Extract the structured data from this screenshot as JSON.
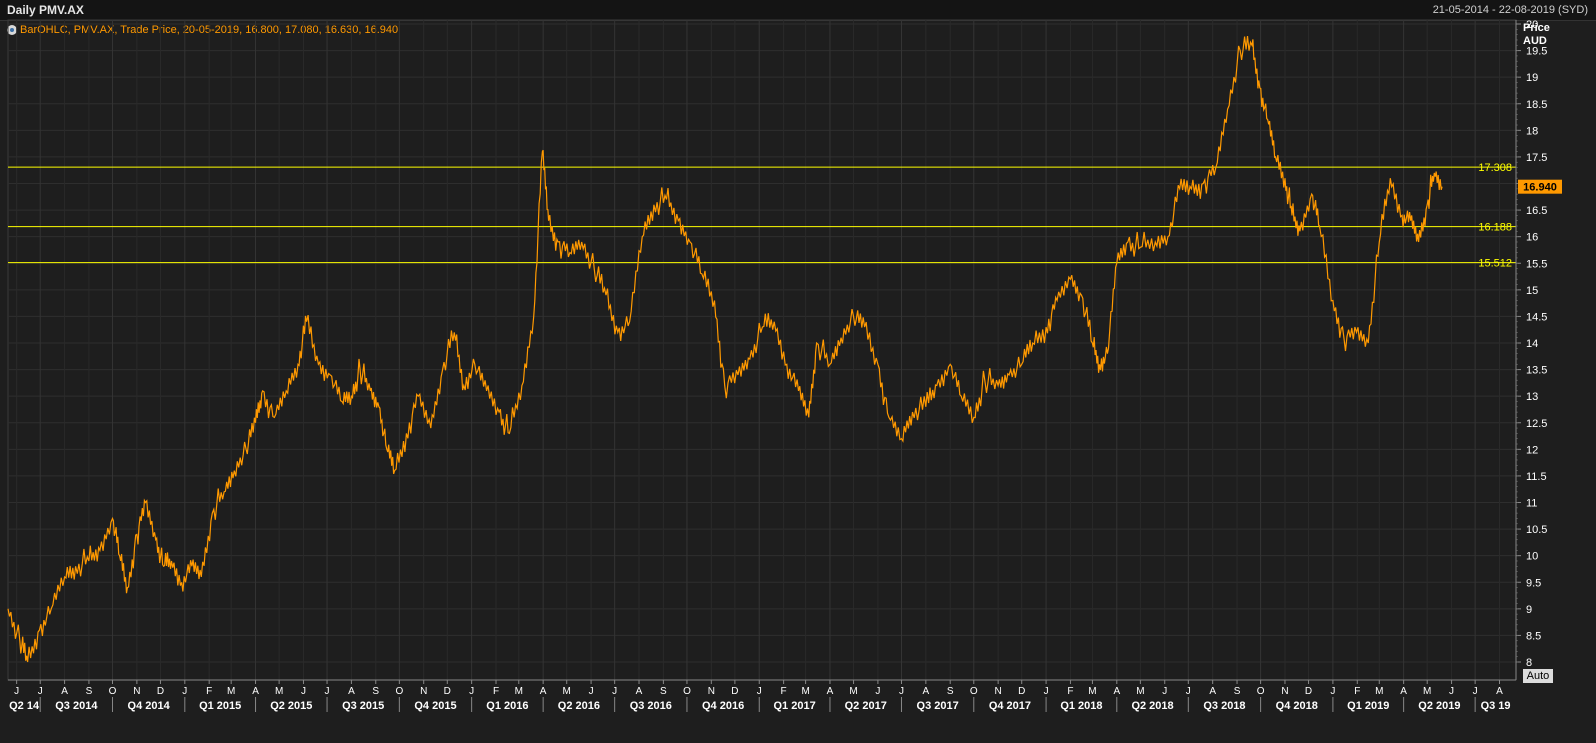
{
  "header": {
    "title": "Daily PMV.AX",
    "date_range": "21-05-2014 - 22-08-2019 (SYD)"
  },
  "legend_text": "BarOHLC, PMV.AX, Trade Price, 20-05-2019, 16.800, 17.080, 16.630, 16.940",
  "axis_title_line1": "Price",
  "axis_title_line2": "AUD",
  "auto_label": "Auto",
  "colors": {
    "background": "#1e1e1e",
    "grid": "#2e2e2e",
    "series": "#ff9900",
    "level_lines": "#ffff00",
    "last_price_bg": "#ff9900"
  },
  "chart_data": {
    "type": "line",
    "title": "Daily PMV.AX",
    "ylabel": "Price AUD",
    "ylim": [
      8,
      20
    ],
    "y_ticks": [
      "8",
      "8.5",
      "9",
      "9.5",
      "10",
      "10.5",
      "11",
      "11.5",
      "12",
      "12.5",
      "13",
      "13.5",
      "14",
      "14.5",
      "15",
      "15.5",
      "16",
      "16.5",
      "17",
      "17.5",
      "18",
      "18.5",
      "19",
      "19.5",
      "20"
    ],
    "month_labels": [
      "J",
      "J",
      "A",
      "S",
      "O",
      "N",
      "D",
      "J",
      "F",
      "M",
      "A",
      "M",
      "J",
      "J",
      "A",
      "S",
      "O",
      "N",
      "D",
      "J",
      "F",
      "M",
      "A",
      "M",
      "J",
      "J",
      "A",
      "S",
      "O",
      "N",
      "D",
      "J",
      "F",
      "M",
      "A",
      "M",
      "J",
      "J",
      "A",
      "S",
      "O",
      "N",
      "D",
      "J",
      "F",
      "M",
      "A",
      "M",
      "J",
      "J",
      "A",
      "S",
      "O",
      "N",
      "D",
      "J",
      "F",
      "M",
      "A",
      "M",
      "J",
      "J",
      "A"
    ],
    "quarter_labels": [
      "Q2 14",
      "Q3 2014",
      "Q4 2014",
      "Q1 2015",
      "Q2 2015",
      "Q3 2015",
      "Q4 2015",
      "Q1 2016",
      "Q2 2016",
      "Q3 2016",
      "Q4 2016",
      "Q1 2017",
      "Q2 2017",
      "Q3 2017",
      "Q4 2017",
      "Q1 2018",
      "Q2 2018",
      "Q3 2018",
      "Q4 2018",
      "Q1 2019",
      "Q2 2019",
      "Q3 19"
    ],
    "horizontal_lines": [
      {
        "value": 17.308,
        "label": "17.308"
      },
      {
        "value": 16.188,
        "label": "16.188"
      },
      {
        "value": 15.512,
        "label": "15.512"
      }
    ],
    "last_price": {
      "value": 16.94,
      "label": "16.940"
    },
    "series": [
      {
        "name": "PMV.AX",
        "points": [
          [
            "2014-05-21",
            9.0
          ],
          [
            "2014-06-05",
            8.4
          ],
          [
            "2014-06-15",
            8.0
          ],
          [
            "2014-06-30",
            8.6
          ],
          [
            "2014-07-15",
            9.0
          ],
          [
            "2014-08-01",
            9.6
          ],
          [
            "2014-08-15",
            9.8
          ],
          [
            "2014-09-01",
            9.9
          ],
          [
            "2014-09-15",
            10.1
          ],
          [
            "2014-10-01",
            10.7
          ],
          [
            "2014-10-10",
            10.0
          ],
          [
            "2014-10-20",
            9.4
          ],
          [
            "2014-11-01",
            10.4
          ],
          [
            "2014-11-12",
            11.0
          ],
          [
            "2014-11-25",
            10.3
          ],
          [
            "2014-12-05",
            9.8
          ],
          [
            "2014-12-15",
            9.9
          ],
          [
            "2014-12-28",
            9.5
          ],
          [
            "2015-01-10",
            9.8
          ],
          [
            "2015-01-22",
            9.6
          ],
          [
            "2015-02-05",
            10.8
          ],
          [
            "2015-02-20",
            11.2
          ],
          [
            "2015-03-05",
            11.6
          ],
          [
            "2015-03-20",
            12.0
          ],
          [
            "2015-04-01",
            12.5
          ],
          [
            "2015-04-10",
            13.1
          ],
          [
            "2015-04-25",
            12.6
          ],
          [
            "2015-05-10",
            13.1
          ],
          [
            "2015-05-25",
            13.6
          ],
          [
            "2015-06-05",
            14.4
          ],
          [
            "2015-06-20",
            13.6
          ],
          [
            "2015-07-05",
            13.4
          ],
          [
            "2015-07-20",
            12.9
          ],
          [
            "2015-08-01",
            13.0
          ],
          [
            "2015-08-12",
            13.5
          ],
          [
            "2015-08-25",
            13.1
          ],
          [
            "2015-09-05",
            12.8
          ],
          [
            "2015-09-15",
            12.0
          ],
          [
            "2015-09-25",
            11.6
          ],
          [
            "2015-10-10",
            12.3
          ],
          [
            "2015-10-25",
            13.0
          ],
          [
            "2015-11-10",
            12.4
          ],
          [
            "2015-11-25",
            13.5
          ],
          [
            "2015-12-10",
            14.2
          ],
          [
            "2015-12-22",
            13.2
          ],
          [
            "2016-01-05",
            13.6
          ],
          [
            "2016-01-20",
            13.1
          ],
          [
            "2016-02-05",
            12.7
          ],
          [
            "2016-02-18",
            12.3
          ],
          [
            "2016-03-05",
            13.2
          ],
          [
            "2016-03-20",
            14.5
          ],
          [
            "2016-03-31",
            17.6
          ],
          [
            "2016-04-08",
            16.3
          ],
          [
            "2016-04-20",
            15.9
          ],
          [
            "2016-05-05",
            15.7
          ],
          [
            "2016-05-20",
            15.9
          ],
          [
            "2016-06-05",
            15.4
          ],
          [
            "2016-06-20",
            14.9
          ],
          [
            "2016-07-05",
            14.2
          ],
          [
            "2016-07-20",
            14.4
          ],
          [
            "2016-08-05",
            16.0
          ],
          [
            "2016-08-20",
            16.6
          ],
          [
            "2016-09-05",
            16.7
          ],
          [
            "2016-09-20",
            16.3
          ],
          [
            "2016-10-05",
            15.9
          ],
          [
            "2016-10-20",
            15.3
          ],
          [
            "2016-11-05",
            14.8
          ],
          [
            "2016-11-18",
            13.2
          ],
          [
            "2016-12-05",
            13.4
          ],
          [
            "2016-12-20",
            13.7
          ],
          [
            "2017-01-05",
            14.3
          ],
          [
            "2017-01-20",
            14.4
          ],
          [
            "2017-02-05",
            13.6
          ],
          [
            "2017-02-20",
            13.1
          ],
          [
            "2017-03-05",
            12.6
          ],
          [
            "2017-03-15",
            14.0
          ],
          [
            "2017-04-01",
            13.6
          ],
          [
            "2017-04-15",
            14.1
          ],
          [
            "2017-05-01",
            14.5
          ],
          [
            "2017-05-15",
            14.3
          ],
          [
            "2017-06-01",
            13.6
          ],
          [
            "2017-06-15",
            12.6
          ],
          [
            "2017-07-01",
            12.2
          ],
          [
            "2017-07-15",
            12.7
          ],
          [
            "2017-08-01",
            12.8
          ],
          [
            "2017-08-15",
            13.2
          ],
          [
            "2017-09-01",
            13.6
          ],
          [
            "2017-09-15",
            13.0
          ],
          [
            "2017-10-01",
            12.6
          ],
          [
            "2017-10-15",
            13.3
          ],
          [
            "2017-11-01",
            13.2
          ],
          [
            "2017-11-15",
            13.4
          ],
          [
            "2017-12-01",
            13.6
          ],
          [
            "2017-12-15",
            14.0
          ],
          [
            "2018-01-01",
            14.3
          ],
          [
            "2018-01-15",
            14.8
          ],
          [
            "2018-02-01",
            15.2
          ],
          [
            "2018-02-15",
            14.9
          ],
          [
            "2018-03-01",
            14.0
          ],
          [
            "2018-03-10",
            13.6
          ],
          [
            "2018-03-20",
            13.8
          ],
          [
            "2018-04-01",
            15.5
          ],
          [
            "2018-04-15",
            15.9
          ],
          [
            "2018-05-01",
            15.8
          ],
          [
            "2018-05-20",
            15.9
          ],
          [
            "2018-06-05",
            16.0
          ],
          [
            "2018-06-20",
            16.9
          ],
          [
            "2018-07-05",
            16.9
          ],
          [
            "2018-07-20",
            17.0
          ],
          [
            "2018-08-05",
            17.3
          ],
          [
            "2018-08-20",
            18.4
          ],
          [
            "2018-09-05",
            19.5
          ],
          [
            "2018-09-20",
            19.6
          ],
          [
            "2018-09-30",
            18.8
          ],
          [
            "2018-10-10",
            18.2
          ],
          [
            "2018-10-20",
            17.5
          ],
          [
            "2018-11-01",
            17.1
          ],
          [
            "2018-11-10",
            16.4
          ],
          [
            "2018-11-20",
            16.1
          ],
          [
            "2018-12-05",
            16.8
          ],
          [
            "2018-12-15",
            16.2
          ],
          [
            "2019-01-01",
            14.8
          ],
          [
            "2019-01-15",
            14.1
          ],
          [
            "2019-01-31",
            14.2
          ],
          [
            "2019-02-15",
            14.0
          ],
          [
            "2019-03-01",
            15.9
          ],
          [
            "2019-03-15",
            17.1
          ],
          [
            "2019-03-30",
            16.4
          ],
          [
            "2019-04-10",
            16.3
          ],
          [
            "2019-04-20",
            15.9
          ],
          [
            "2019-05-01",
            16.6
          ],
          [
            "2019-05-10",
            17.2
          ],
          [
            "2019-05-20",
            16.94
          ]
        ]
      }
    ]
  }
}
